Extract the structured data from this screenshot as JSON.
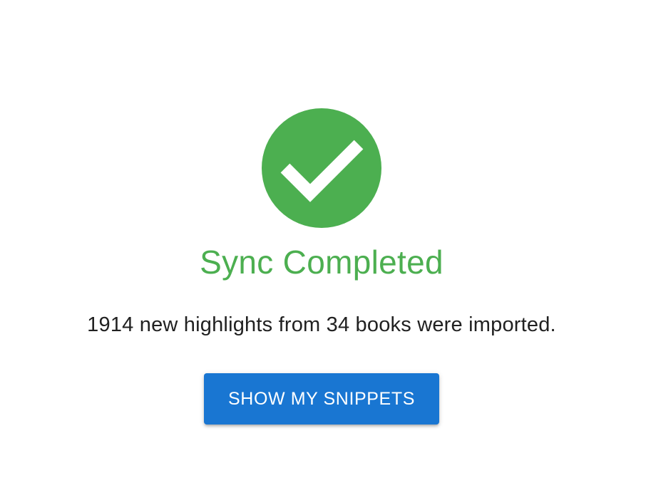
{
  "status": {
    "icon": "check-circle-icon",
    "title": "Sync Completed",
    "message": "1914 new highlights from 34 books were imported."
  },
  "actions": {
    "primary_label": "SHOW MY SNIPPETS"
  },
  "colors": {
    "success": "#4caf50",
    "primary": "#1976d2",
    "text": "#212121",
    "background": "#ffffff"
  }
}
